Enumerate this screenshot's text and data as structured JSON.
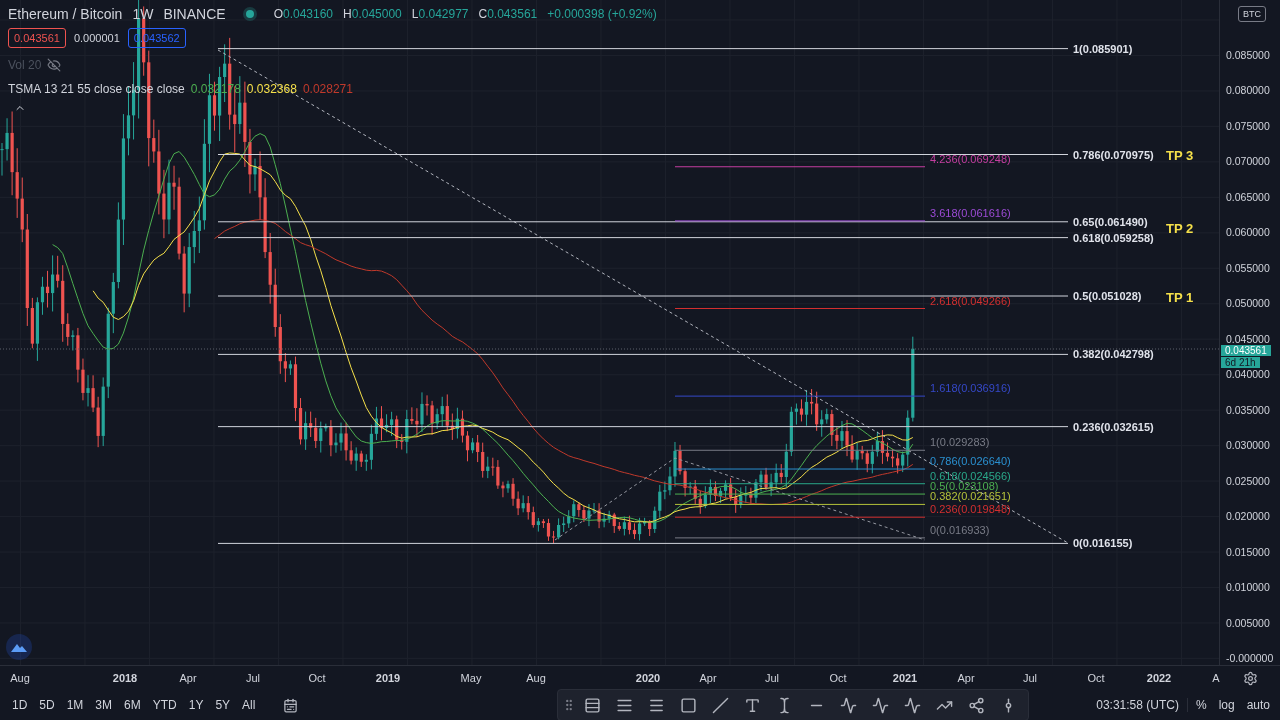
{
  "header": {
    "symbol": "Ethereum / Bitcoin",
    "interval": "1W",
    "exchange": "BINANCE",
    "market_open": true,
    "ohlc": [
      {
        "key": "O",
        "value": "0.043160"
      },
      {
        "key": "H",
        "value": "0.045000"
      },
      {
        "key": "L",
        "value": "0.042977"
      },
      {
        "key": "C",
        "value": "0.043561"
      }
    ],
    "change": "+0.000398 (+0.92%)"
  },
  "trade": {
    "sell": "0.043561",
    "spread": "0.000001",
    "buy": "0.043562"
  },
  "indicators": [
    {
      "name": "Vol 20",
      "hidden": true
    },
    {
      "name": "TSMA 13 21 55 close close close",
      "hidden": false,
      "values": [
        {
          "text": "0.032178",
          "color": "#4caf50"
        },
        {
          "text": "0.032368",
          "color": "#f5e04a"
        },
        {
          "text": "0.028271",
          "color": "#c0392b"
        }
      ]
    }
  ],
  "fib_main": [
    "1(0.085901)",
    "0.786(0.070975)",
    "0.65(0.061490)",
    "0.618(0.059258)",
    "0.5(0.051028)",
    "0.382(0.042798)",
    "0.236(0.032615)",
    "0(0.016155)"
  ],
  "fib_extension": [
    {
      "label": "4.236(0.069248)",
      "color": "#c43ea0"
    },
    {
      "label": "3.618(0.061616)",
      "color": "#9c4bd6"
    },
    {
      "label": "2.618(0.049266)",
      "color": "#d32f2f"
    },
    {
      "label": "1.618(0.036916)",
      "color": "#3548c8"
    },
    {
      "label": "1(0.029283)",
      "color": "#787b86"
    },
    {
      "label": "0.786(0.026640)",
      "color": "#2a90d0"
    },
    {
      "label": "0.618(0.024566)",
      "color": "#2aa88a"
    },
    {
      "label": "0.5(0.023108)",
      "color": "#4caf50"
    },
    {
      "label": "0.382(0.021651)",
      "color": "#b5c23a"
    },
    {
      "label": "0.236(0.019848)",
      "color": "#d32f2f"
    },
    {
      "label": "0(0.016933)",
      "color": "#787b86"
    }
  ],
  "targets": [
    "TP 3",
    "TP 2",
    "TP 1"
  ],
  "price_axis": {
    "currency": "BTC",
    "ticks": [
      "0.085000",
      "0.080000",
      "0.075000",
      "0.070000",
      "0.065000",
      "0.060000",
      "0.055000",
      "0.050000",
      "0.045000",
      "0.040000",
      "0.035000",
      "0.030000",
      "0.025000",
      "0.020000",
      "0.015000",
      "0.010000",
      "0.005000",
      "-0.000000"
    ],
    "last_price": "0.043561",
    "countdown": "6d 21h"
  },
  "time_axis": [
    {
      "label": "Aug",
      "kind": "month"
    },
    {
      "label": "2018",
      "kind": "year"
    },
    {
      "label": "Apr",
      "kind": "month"
    },
    {
      "label": "Jul",
      "kind": "month"
    },
    {
      "label": "Oct",
      "kind": "month"
    },
    {
      "label": "2019",
      "kind": "year"
    },
    {
      "label": "May",
      "kind": "month"
    },
    {
      "label": "Aug",
      "kind": "month"
    },
    {
      "label": "2020",
      "kind": "year"
    },
    {
      "label": "Apr",
      "kind": "month"
    },
    {
      "label": "Jul",
      "kind": "month"
    },
    {
      "label": "Oct",
      "kind": "month"
    },
    {
      "label": "2021",
      "kind": "year"
    },
    {
      "label": "Apr",
      "kind": "month"
    },
    {
      "label": "Jul",
      "kind": "month"
    },
    {
      "label": "Oct",
      "kind": "month"
    },
    {
      "label": "2022",
      "kind": "year"
    },
    {
      "label": "A",
      "kind": "month"
    }
  ],
  "bottom_bar": {
    "ranges": [
      "1D",
      "5D",
      "1M",
      "3M",
      "6M",
      "YTD",
      "1Y",
      "5Y",
      "All"
    ],
    "clock": "03:31:58 (UTC)",
    "scale_buttons": [
      "%",
      "log",
      "auto"
    ]
  }
}
